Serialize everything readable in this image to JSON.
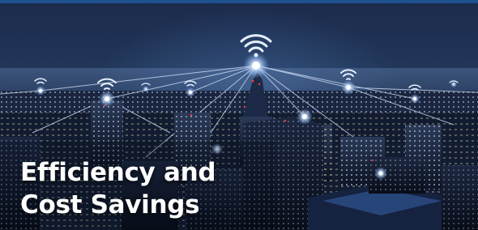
{
  "headline": {
    "line1": "Efficiency and",
    "line2": "Cost Savings"
  },
  "colors": {
    "top_border": "#1d4f91",
    "sky": "#213658",
    "wifi_glow": "#dfeeff",
    "headline_text": "#ffffff"
  },
  "icons": {
    "network_hub": "wifi-signal-icon"
  }
}
